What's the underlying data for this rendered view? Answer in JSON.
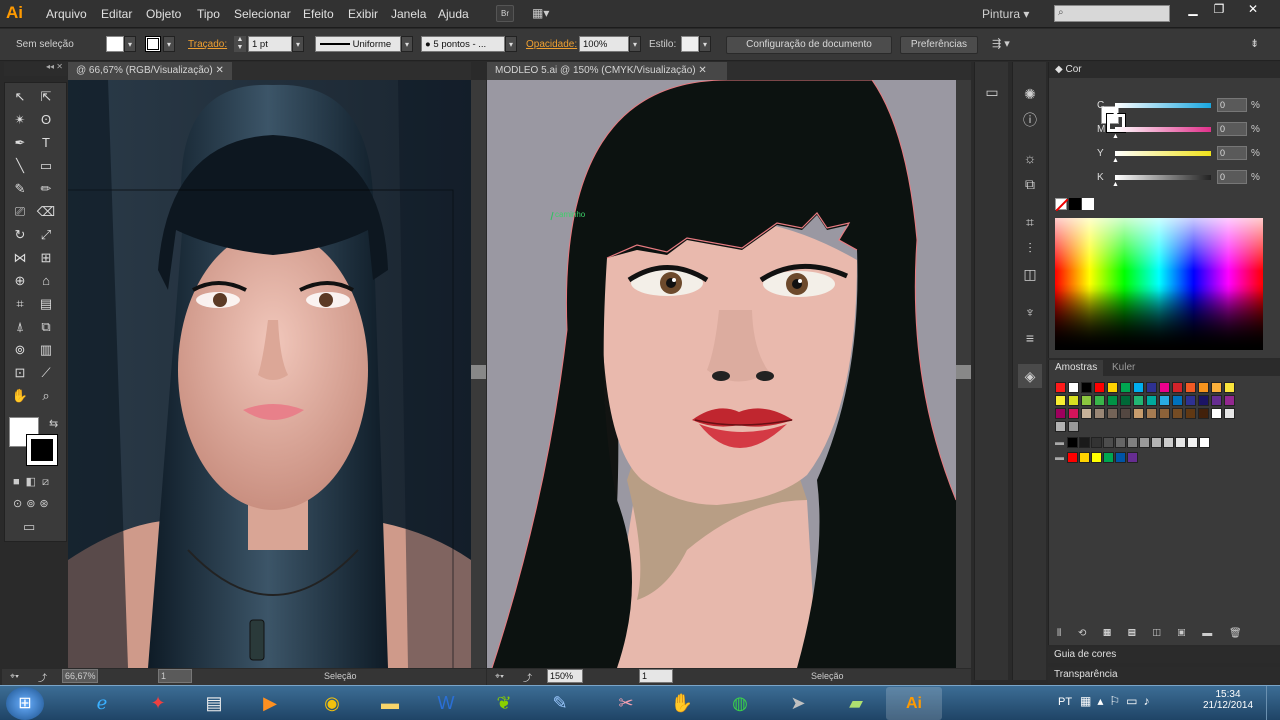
{
  "app": {
    "logo": "Ai",
    "workspace": "Pintura"
  },
  "menu": [
    "Arquivo",
    "Editar",
    "Objeto",
    "Tipo",
    "Selecionar",
    "Efeito",
    "Exibir",
    "Janela",
    "Ajuda"
  ],
  "menubar_buttons": {
    "bridge": "Br"
  },
  "control": {
    "selection_label": "Sem seleção",
    "stroke_label": "Traçado:",
    "stroke_weight": "1 pt",
    "profile": "Uniforme",
    "brush": "5 pontos - ...",
    "opacity_label": "Opacidade:",
    "opacity_value": "100%",
    "style_label": "Estilo:",
    "doc_setup": "Configuração de documento",
    "preferences": "Preferências"
  },
  "doc1": {
    "tab": "@ 66,67% (RGB/Visualização)",
    "zoom": "66,67%",
    "page": "1",
    "status": "Seleção"
  },
  "doc2": {
    "tab": "MODLEO 5.ai @ 150% (CMYK/Visualização)",
    "zoom": "150%",
    "page": "1",
    "status": "Seleção",
    "path_label": "caminho"
  },
  "color_panel": {
    "title": "Cor",
    "channels": [
      {
        "name": "C",
        "value": "0",
        "unit": "%",
        "color": "#19a7e0"
      },
      {
        "name": "M",
        "value": "0",
        "unit": "%",
        "color": "#e0308a"
      },
      {
        "name": "Y",
        "value": "0",
        "unit": "%",
        "color": "#f0e21a"
      },
      {
        "name": "K",
        "value": "0",
        "unit": "%",
        "color": "#222222"
      }
    ]
  },
  "swatches_panel": {
    "tabs": [
      "Amostras",
      "Kuler"
    ],
    "row1": [
      "#ff1a1a",
      "#ffffff",
      "#000000",
      "#ff0000",
      "#ffd200",
      "#00a651",
      "#00aeef",
      "#2e3192",
      "#ec008c",
      "#d2232a",
      "#f15a24",
      "#f7941d",
      "#fbb03b",
      "#f9e43b"
    ],
    "row2": [
      "#f9ed32",
      "#d9e021",
      "#8cc63f",
      "#39b54a",
      "#009245",
      "#006837",
      "#22b573",
      "#00a99d",
      "#29abe2",
      "#0071bc",
      "#2e3192",
      "#1b1464",
      "#662d91",
      "#93278f"
    ],
    "row3": [
      "#9e005d",
      "#d4145a",
      "#c7b299",
      "#998675",
      "#736357",
      "#534741",
      "#c69c6d",
      "#a67c52",
      "#8c6239",
      "#754c24",
      "#603813",
      "#42210b",
      "#ffffff",
      "#e6e6e6"
    ],
    "row4": [
      "#b3b3b3",
      "#999999"
    ],
    "gray_row": [
      "#000000",
      "#1a1a1a",
      "#333333",
      "#4d4d4d",
      "#666666",
      "#808080",
      "#999999",
      "#b3b3b3",
      "#cccccc",
      "#e6e6e6",
      "#f2f2f2",
      "#ffffff"
    ],
    "bright_row": [
      "#ff0000",
      "#ffd200",
      "#ffff00",
      "#00a651",
      "#0054a6",
      "#662d91"
    ]
  },
  "bottom_panels": {
    "guide": "Guia de cores",
    "transparency": "Transparência"
  },
  "tray": {
    "lang": "PT",
    "time": "15:34",
    "date": "21/12/2014"
  }
}
